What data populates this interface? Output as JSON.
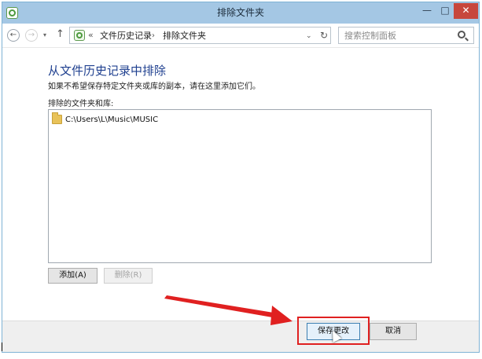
{
  "window": {
    "title": "排除文件夹",
    "controls": {
      "minimize": "—",
      "maximize": "□",
      "close": "✕"
    },
    "app_icon": "file-history-icon"
  },
  "navbar": {
    "back_glyph": "←",
    "forward_glyph": "→",
    "recent_glyph": "▾",
    "up_glyph": "↑",
    "address_prefix": "«",
    "breadcrumb": [
      "文件历史记录",
      "排除文件夹"
    ],
    "separator": "›",
    "dropdown_glyph": "⌄",
    "refresh_glyph": "↻",
    "search_placeholder": "搜索控制面板"
  },
  "content": {
    "heading": "从文件历史记录中排除",
    "description": "如果不希望保存特定文件夹或库的副本，请在这里添加它们。",
    "list_label": "排除的文件夹和库:",
    "items": [
      {
        "path": "C:\\Users\\L\\Music\\MUSIC",
        "icon": "folder-icon"
      }
    ],
    "add_button": "添加(A)",
    "remove_button": "删除(R)"
  },
  "footer": {
    "save_button": "保存更改",
    "cancel_button": "取消"
  },
  "colors": {
    "titlebar": "#a4c7e4",
    "heading": "#1e3f8f",
    "close_button": "#c7473c",
    "annotation": "#e02020"
  }
}
